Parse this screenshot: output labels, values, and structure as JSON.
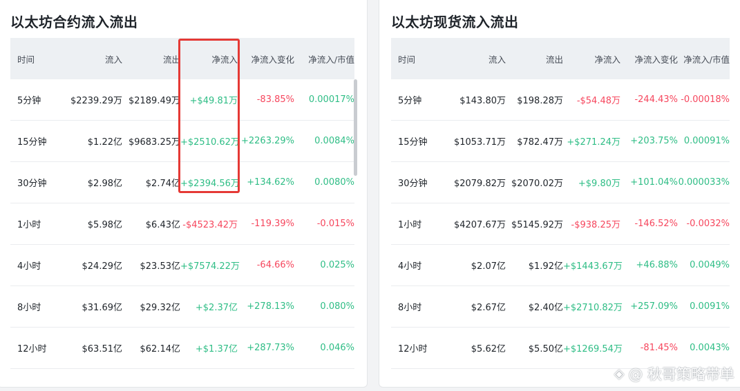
{
  "left_panel": {
    "title": "以太坊合约流入流出",
    "headers": [
      "时间",
      "流入",
      "流出",
      "净流入",
      "净流入变化",
      "净流入/市值"
    ],
    "rows": [
      {
        "time": "5分钟",
        "inflow": "$2239.29万",
        "outflow": "$2189.49万",
        "net": "+$49.81万",
        "change": "-83.85%",
        "ratio": "0.00017%",
        "net_sign": "pos",
        "change_sign": "neg",
        "ratio_sign": "pos"
      },
      {
        "time": "15分钟",
        "inflow": "$1.22亿",
        "outflow": "$9683.25万",
        "net": "+$2510.62万",
        "change": "+2263.29%",
        "ratio": "0.0084%",
        "net_sign": "pos",
        "change_sign": "pos",
        "ratio_sign": "pos"
      },
      {
        "time": "30分钟",
        "inflow": "$2.98亿",
        "outflow": "$2.74亿",
        "net": "+$2394.56万",
        "change": "+134.62%",
        "ratio": "0.0080%",
        "net_sign": "pos",
        "change_sign": "pos",
        "ratio_sign": "pos"
      },
      {
        "time": "1小时",
        "inflow": "$5.98亿",
        "outflow": "$6.43亿",
        "net": "-$4523.42万",
        "change": "-119.39%",
        "ratio": "-0.015%",
        "net_sign": "neg",
        "change_sign": "neg",
        "ratio_sign": "neg"
      },
      {
        "time": "4小时",
        "inflow": "$24.29亿",
        "outflow": "$23.53亿",
        "net": "+$7574.22万",
        "change": "-64.66%",
        "ratio": "0.025%",
        "net_sign": "pos",
        "change_sign": "neg",
        "ratio_sign": "pos"
      },
      {
        "time": "8小时",
        "inflow": "$31.69亿",
        "outflow": "$29.32亿",
        "net": "+$2.37亿",
        "change": "+278.13%",
        "ratio": "0.080%",
        "net_sign": "pos",
        "change_sign": "pos",
        "ratio_sign": "pos"
      },
      {
        "time": "12小时",
        "inflow": "$63.51亿",
        "outflow": "$62.14亿",
        "net": "+$1.37亿",
        "change": "+287.73%",
        "ratio": "0.046%",
        "net_sign": "pos",
        "change_sign": "pos",
        "ratio_sign": "pos"
      }
    ]
  },
  "right_panel": {
    "title": "以太坊现货流入流出",
    "headers": [
      "时间",
      "流入",
      "流出",
      "净流入",
      "净流入变化",
      "净流入/市值"
    ],
    "rows": [
      {
        "time": "5分钟",
        "inflow": "$143.80万",
        "outflow": "$198.28万",
        "net": "-$54.48万",
        "change": "-244.43%",
        "ratio": "-0.00018%",
        "net_sign": "neg",
        "change_sign": "neg",
        "ratio_sign": "neg"
      },
      {
        "time": "15分钟",
        "inflow": "$1053.71万",
        "outflow": "$782.47万",
        "net": "+$271.24万",
        "change": "+203.75%",
        "ratio": "0.00091%",
        "net_sign": "pos",
        "change_sign": "pos",
        "ratio_sign": "pos"
      },
      {
        "time": "30分钟",
        "inflow": "$2079.82万",
        "outflow": "$2070.02万",
        "net": "+$9.80万",
        "change": "+101.04%",
        "ratio": "0.000033%",
        "net_sign": "pos",
        "change_sign": "pos",
        "ratio_sign": "pos"
      },
      {
        "time": "1小时",
        "inflow": "$4207.67万",
        "outflow": "$5145.92万",
        "net": "-$938.25万",
        "change": "-146.52%",
        "ratio": "-0.0032%",
        "net_sign": "neg",
        "change_sign": "neg",
        "ratio_sign": "neg"
      },
      {
        "time": "4小时",
        "inflow": "$2.07亿",
        "outflow": "$1.92亿",
        "net": "+$1443.67万",
        "change": "+46.88%",
        "ratio": "0.0049%",
        "net_sign": "pos",
        "change_sign": "pos",
        "ratio_sign": "pos"
      },
      {
        "time": "8小时",
        "inflow": "$2.67亿",
        "outflow": "$2.40亿",
        "net": "+$2710.82万",
        "change": "+257.09%",
        "ratio": "0.0091%",
        "net_sign": "pos",
        "change_sign": "pos",
        "ratio_sign": "pos"
      },
      {
        "time": "12小时",
        "inflow": "$5.62亿",
        "outflow": "$5.50亿",
        "net": "+$1269.54万",
        "change": "-81.45%",
        "ratio": "0.0043%",
        "net_sign": "pos",
        "change_sign": "neg",
        "ratio_sign": "pos"
      }
    ]
  },
  "watermark": {
    "text": "@ 秋哥策略带单",
    "icon": "binance-diamond-icon"
  },
  "colors": {
    "positive": "#2ebd85",
    "negative": "#f6465d",
    "highlight": "#e53935",
    "header_bg": "#edf0f3"
  }
}
